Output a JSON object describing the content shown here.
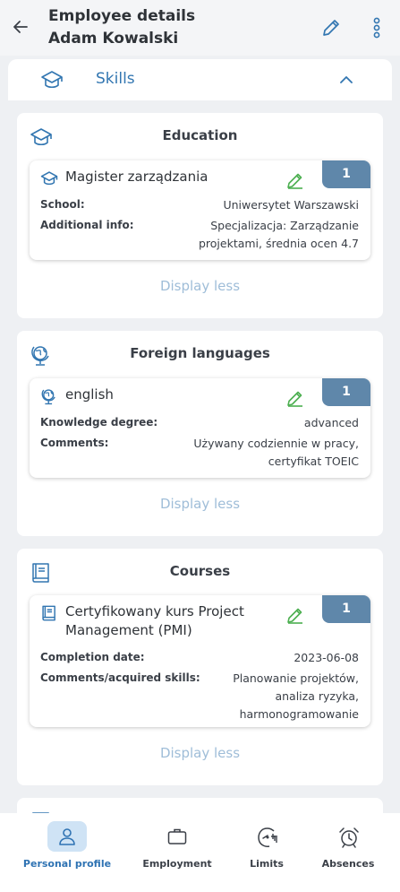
{
  "header": {
    "title_line1": "Employee details",
    "title_line2": "Adam Kowalski"
  },
  "skills_bar": {
    "label": "Skills"
  },
  "sections": [
    {
      "title": "Education",
      "card": {
        "title": "Magister zarządzania",
        "count": "1",
        "rows": [
          {
            "label": "School:",
            "value": "Uniwersytet Warszawski"
          },
          {
            "label": "Additional info:",
            "value_line1": "Specjalizacja: Zarządzanie",
            "value_line2": "projektami, średnia ocen 4.7"
          }
        ]
      },
      "display_less": "Display less"
    },
    {
      "title": "Foreign languages",
      "card": {
        "title": "english",
        "count": "1",
        "rows": [
          {
            "label": "Knowledge degree:",
            "value": "advanced"
          },
          {
            "label": "Comments:",
            "value_line1": "Używany codziennie w pracy,",
            "value_line2": "certyfikat TOEIC"
          }
        ]
      },
      "display_less": "Display less"
    },
    {
      "title": "Courses",
      "card": {
        "title_line1": "Certyfikowany kurs Project",
        "title_line2": "Management (PMI)",
        "count": "1",
        "rows": [
          {
            "label": "Completion date:",
            "value": "2023-06-08"
          },
          {
            "label": "Comments/acquired skills:",
            "value_line1": "Planowanie projektów,",
            "value_line2": "analiza ryzyka,",
            "value_line3": "harmonogramowanie"
          }
        ]
      },
      "display_less": "Display less"
    }
  ],
  "bottom_nav": [
    {
      "label": "Personal profile",
      "icon": "person-icon",
      "active": true
    },
    {
      "label": "Employment",
      "icon": "briefcase-icon",
      "active": false
    },
    {
      "label": "Limits",
      "icon": "gauge-icon",
      "active": false
    },
    {
      "label": "Absences",
      "icon": "alarm-clock-icon",
      "active": false
    }
  ],
  "colors": {
    "accent": "#3276b1",
    "badge": "#5f87aa",
    "edit_green": "#4caf50",
    "display_less": "#9fbdd8",
    "nav_active_bg": "#cfe3f5"
  }
}
